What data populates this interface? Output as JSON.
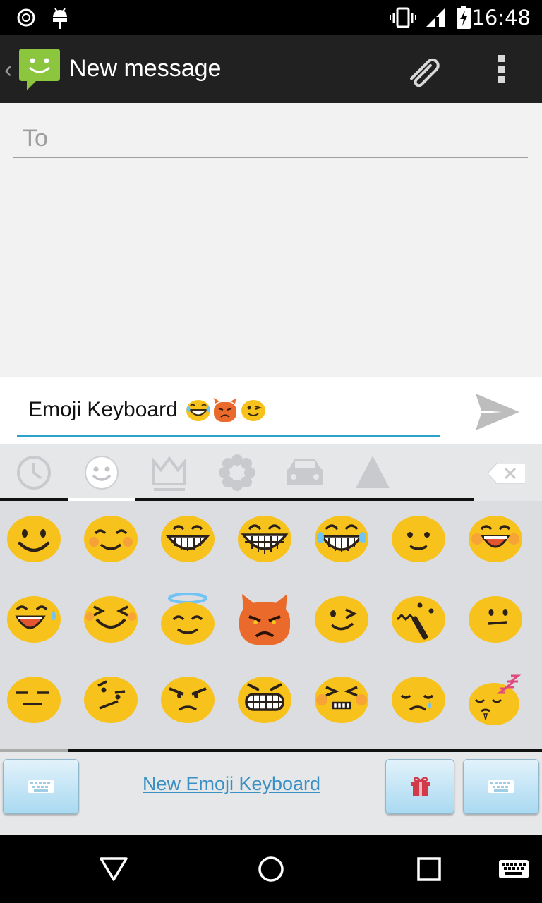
{
  "status_bar": {
    "time": "16:48"
  },
  "action_bar": {
    "title": "New message"
  },
  "compose": {
    "to_placeholder": "To",
    "message_text": "Emoji Keyboard"
  },
  "keyboard": {
    "link_label": "New Emoji Keyboard",
    "categories": [
      "recent",
      "smileys",
      "objects",
      "nature",
      "places",
      "symbols"
    ],
    "selected_category": "smileys"
  },
  "colors": {
    "emoji_yellow": "#f8c21c",
    "devil_orange": "#ea6a2c",
    "accent_blue": "#2ea3c9",
    "link_blue": "#3a90c4"
  }
}
